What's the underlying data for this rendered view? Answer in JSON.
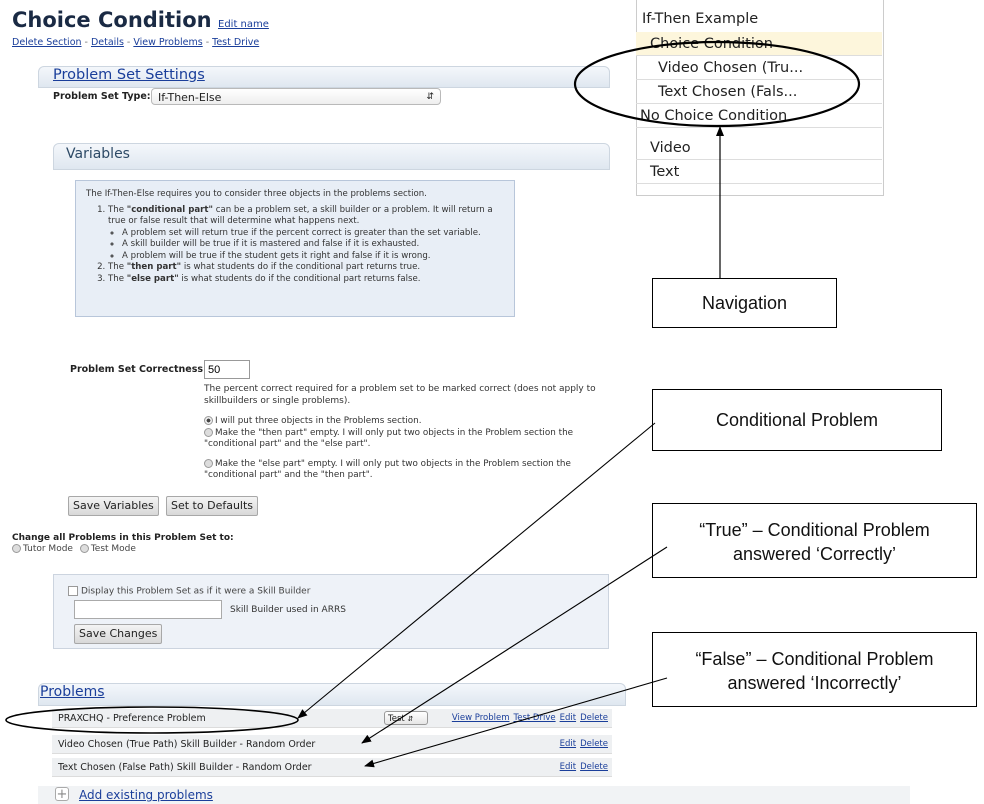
{
  "header": {
    "title": "Choice Condition",
    "edit_name": "Edit name",
    "links": [
      "Delete Section",
      "Details",
      "View Problems",
      "Test Drive"
    ],
    "separator": "-"
  },
  "settings": {
    "title": "Problem Set Settings",
    "type_label": "Problem Set Type:",
    "type_value": "If-Then-Else"
  },
  "variables": {
    "title": "Variables",
    "intro": "The If-Then-Else requires you to consider three objects in the problems section.",
    "item1_bold": "\"conditional part\"",
    "item1_pre": "The ",
    "item1_text": " can be a problem set, a skill builder or a problem. It will return a true or false result that will determine what happens next.",
    "bullets": [
      "A problem set will return true if the percent correct is greater than the set variable.",
      "A skill builder will be true if it is mastered and false if it is exhausted.",
      "A problem will be true if the student gets it right and false if it is wrong."
    ],
    "item2_pre": "The ",
    "item2_bold": "\"then part\"",
    "item2_text": " is what students do if the conditional part returns true.",
    "item3_pre": "The ",
    "item3_bold": "\"else part\"",
    "item3_text": " is what students do if the conditional part returns false.",
    "correctness_label": "Problem Set Correctness:",
    "correctness_value": "50",
    "correctness_desc": "The percent correct required for a problem set to be marked correct (does not apply to skillbuilders or single problems).",
    "radio1": "I will put three objects in the Problems section.",
    "radio2": "Make the \"then part\" empty. I will only put two objects in the Problem section the \"conditional part\" and the \"else part\".",
    "radio3": "Make the \"else part\" empty. I will only put two objects in the Problem section the \"conditional part\" and the \"then part\".",
    "save_button": "Save Variables",
    "defaults_button": "Set to Defaults"
  },
  "mode": {
    "label": "Change all Problems in this Problem Set to:",
    "tutor": "Tutor Mode",
    "test": "Test Mode"
  },
  "skill_builder": {
    "checkbox_label": "Display this Problem Set as if it were a Skill Builder",
    "input_label": "Skill Builder used in ARRS",
    "save_button": "Save Changes"
  },
  "problems": {
    "title": "Problems",
    "rows": [
      {
        "label": "PRAXCHQ - Preference Problem",
        "type": "Test",
        "actions": [
          "View Problem",
          "Test Drive",
          "Edit",
          "Delete"
        ]
      },
      {
        "label": "Video Chosen (True Path) Skill Builder - Random Order",
        "actions": [
          "Edit",
          "Delete"
        ]
      },
      {
        "label": "Text Chosen (False Path) Skill Builder - Random Order",
        "actions": [
          "Edit",
          "Delete"
        ]
      }
    ],
    "add_link": "Add existing problems"
  },
  "nav": {
    "items": [
      "If-Then Example",
      "Choice Condition",
      "Video Chosen (Tru...",
      "Text Chosen (Fals...",
      "No Choice Condition",
      "Video",
      "Text"
    ],
    "active_index": 1
  },
  "callouts": {
    "navigation": "Navigation",
    "conditional": "Conditional Problem",
    "true_line1": "“True” – Conditional Problem",
    "true_line2": "answered ‘Correctly’",
    "false_line1": "“False” – Conditional Problem",
    "false_line2": "answered ‘Incorrectly’"
  },
  "colors": {
    "link": "#1a3e9a",
    "nav_active": "#fdf6dc",
    "panel_bg": "#e8eef6"
  }
}
